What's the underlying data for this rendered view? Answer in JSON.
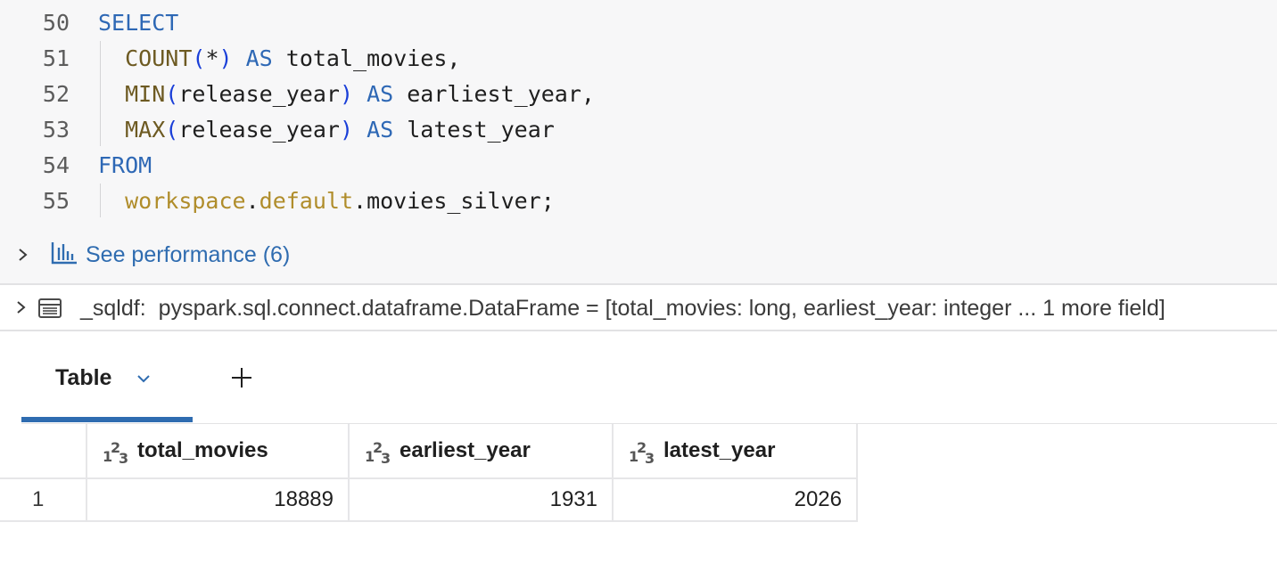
{
  "editor": {
    "lines": [
      {
        "num": "50",
        "tokens": [
          {
            "t": "SELECT",
            "c": "kw"
          }
        ]
      },
      {
        "num": "51",
        "tokens": [
          {
            "t": "  ",
            "c": "plain"
          },
          {
            "t": "COUNT",
            "c": "fn"
          },
          {
            "t": "(",
            "c": "paren"
          },
          {
            "t": "*",
            "c": "plain"
          },
          {
            "t": ")",
            "c": "paren"
          },
          {
            "t": " AS ",
            "c": "kw"
          },
          {
            "t": "total_movies,",
            "c": "plain"
          }
        ]
      },
      {
        "num": "52",
        "tokens": [
          {
            "t": "  ",
            "c": "plain"
          },
          {
            "t": "MIN",
            "c": "fn"
          },
          {
            "t": "(",
            "c": "paren"
          },
          {
            "t": "release_year",
            "c": "plain"
          },
          {
            "t": ")",
            "c": "paren"
          },
          {
            "t": " AS ",
            "c": "kw"
          },
          {
            "t": "earliest_year,",
            "c": "plain"
          }
        ]
      },
      {
        "num": "53",
        "tokens": [
          {
            "t": "  ",
            "c": "plain"
          },
          {
            "t": "MAX",
            "c": "fn"
          },
          {
            "t": "(",
            "c": "paren"
          },
          {
            "t": "release_year",
            "c": "plain"
          },
          {
            "t": ")",
            "c": "paren"
          },
          {
            "t": " AS ",
            "c": "kw"
          },
          {
            "t": "latest_year",
            "c": "plain"
          }
        ]
      },
      {
        "num": "54",
        "tokens": [
          {
            "t": "FROM",
            "c": "kw"
          }
        ]
      },
      {
        "num": "55",
        "tokens": [
          {
            "t": "  ",
            "c": "plain"
          },
          {
            "t": "workspace",
            "c": "ident"
          },
          {
            "t": ".",
            "c": "plain"
          },
          {
            "t": "default",
            "c": "ident"
          },
          {
            "t": ".",
            "c": "plain"
          },
          {
            "t": "movies_silver;",
            "c": "plain"
          }
        ]
      }
    ]
  },
  "performance": {
    "label": "See performance (6)",
    "icon": "bar-chart-icon"
  },
  "dataframe": {
    "var": "_sqldf:",
    "type_text": "pyspark.sql.connect.dataframe.DataFrame = [total_movies: long, earliest_year: integer ... 1 more field]",
    "icon": "table-icon"
  },
  "tabs": {
    "active_label": "Table",
    "add_icon": "plus-icon"
  },
  "table": {
    "columns": [
      {
        "name": "total_movies",
        "type_icon": "numeric-type-icon"
      },
      {
        "name": "earliest_year",
        "type_icon": "numeric-type-icon"
      },
      {
        "name": "latest_year",
        "type_icon": "numeric-type-icon"
      }
    ],
    "rows": [
      {
        "index": "1",
        "values": [
          "18889",
          "1931",
          "2026"
        ]
      }
    ]
  },
  "colors": {
    "keyword": "#2e68b5",
    "function": "#6d5a22",
    "paren": "#1a3fd8",
    "identifier": "#b08d2b",
    "link": "#2f6cb0",
    "tab_underline": "#2f6cb0"
  }
}
